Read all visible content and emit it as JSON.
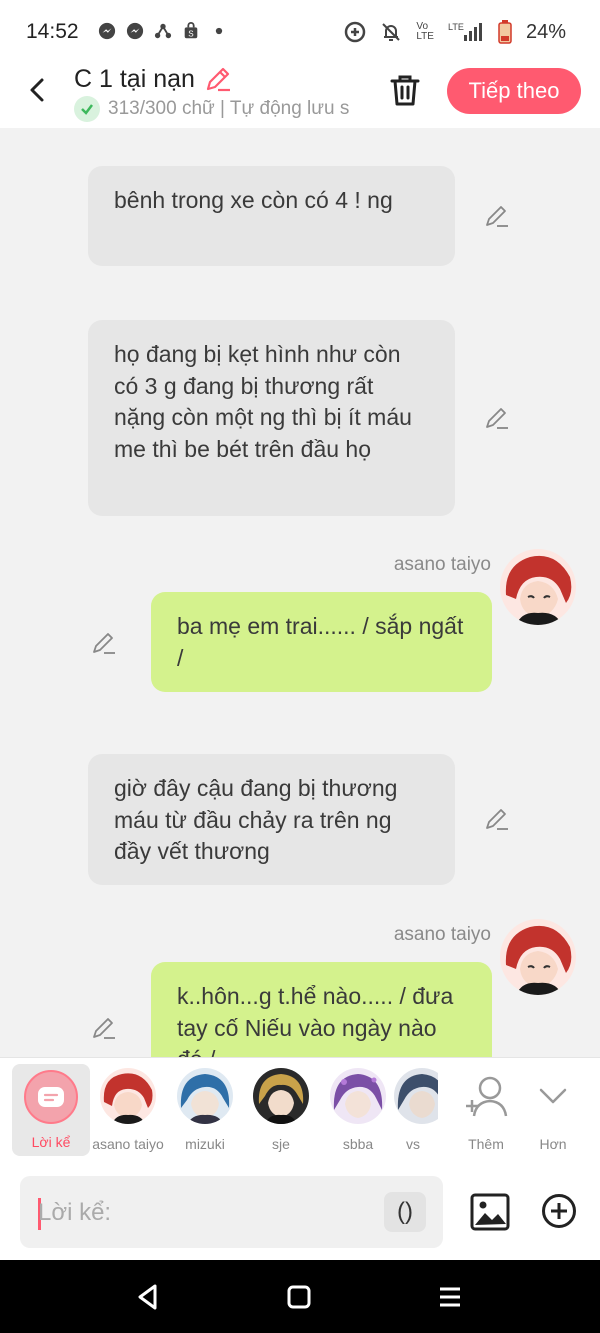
{
  "status": {
    "time": "14:52",
    "battery": "24%",
    "network": "LTE"
  },
  "header": {
    "title": "C 1 tại nạn",
    "subtitle": "313/300 chữ | Tự động lưu s",
    "next_label": "Tiếp theo"
  },
  "messages": [
    {
      "type": "narration",
      "text": "bênh trong xe còn có 4 ! ng"
    },
    {
      "type": "narration",
      "text": "họ đang bị kẹt hình như còn có 3  g đang bị thương rất nặng còn một ng thì bị ít máu me thì be bét trên đầu họ"
    },
    {
      "type": "character",
      "speaker": "asano taiyo",
      "text": "ba mẹ em trai...... / sắp ngất /"
    },
    {
      "type": "narration",
      "text": "giờ đây cậu đang bị thương máu từ đầu chảy ra trên ng đầy vết thương"
    },
    {
      "type": "character",
      "speaker": "asano taiyo",
      "text": "k..hôn...g t.hể nào.....  / đưa tay cố Niếu vào ngày nào đó /"
    }
  ],
  "characters": {
    "narration_label": "Lời kể",
    "list": [
      {
        "name": "asano taiyo",
        "color": "#c2332d"
      },
      {
        "name": "mizuki",
        "color": "#2f6fa8"
      },
      {
        "name": "sje",
        "color": "#c9a24a"
      },
      {
        "name": "sbba",
        "color": "#7b4fa6"
      },
      {
        "name": "vs",
        "color": "#3d4f6b"
      }
    ],
    "more_label": "Thêm",
    "collapse_label": "Hơn"
  },
  "input": {
    "placeholder": "Lời kể:",
    "paren_label": "()"
  }
}
